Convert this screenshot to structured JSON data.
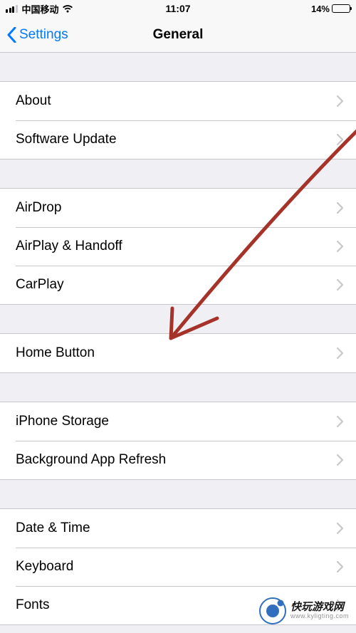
{
  "status": {
    "carrier": "中国移动",
    "time": "11:07",
    "battery_percent": "14%"
  },
  "nav": {
    "back_label": "Settings",
    "title": "General"
  },
  "sections": {
    "g1": {
      "about": "About",
      "software_update": "Software Update"
    },
    "g2": {
      "airdrop": "AirDrop",
      "airplay_handoff": "AirPlay & Handoff",
      "carplay": "CarPlay"
    },
    "g3": {
      "home_button": "Home Button"
    },
    "g4": {
      "iphone_storage": "iPhone Storage",
      "background_app_refresh": "Background App Refresh"
    },
    "g5": {
      "date_time": "Date & Time",
      "keyboard": "Keyboard",
      "fonts": "Fonts"
    }
  },
  "watermark": {
    "main": "快玩游戏网",
    "sub": "www.kyligting.com"
  }
}
